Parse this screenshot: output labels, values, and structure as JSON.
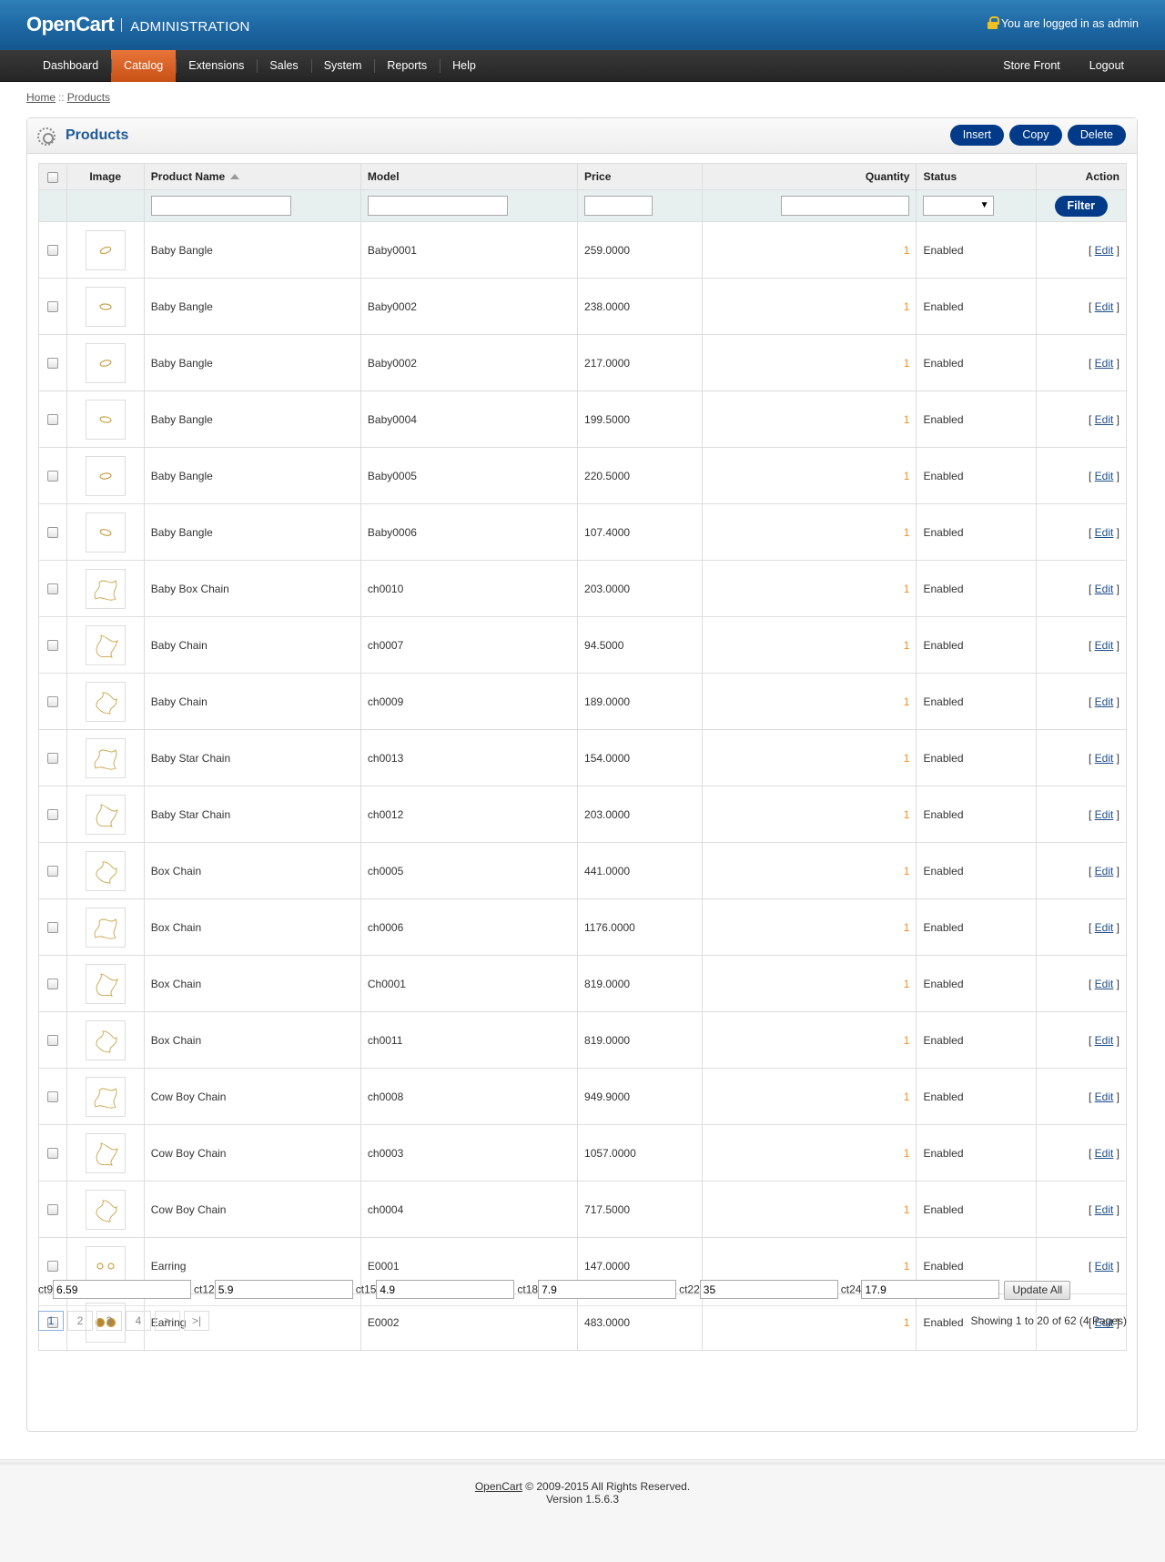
{
  "header": {
    "brand": "OpenCart",
    "subtitle": "ADMINISTRATION",
    "login_text": "You are logged in as admin",
    "lock_icon": "lock-icon"
  },
  "menu": {
    "left": [
      "Dashboard",
      "Catalog",
      "Extensions",
      "Sales",
      "System",
      "Reports",
      "Help"
    ],
    "active": "Catalog",
    "right": [
      "Store Front",
      "Logout"
    ]
  },
  "breadcrumb": {
    "home": "Home",
    "separator": "::",
    "current": "Products"
  },
  "page": {
    "title": "Products",
    "icon": "gear-icon",
    "buttons": {
      "insert": "Insert",
      "copy": "Copy",
      "delete": "Delete"
    }
  },
  "table": {
    "headers": {
      "image": "Image",
      "name": "Product Name",
      "model": "Model",
      "price": "Price",
      "quantity": "Quantity",
      "status": "Status",
      "action": "Action"
    },
    "sort_icon": "sort-asc-icon",
    "filter_button": "Filter",
    "filter_values": {
      "name": "",
      "model": "",
      "price": "",
      "quantity": "",
      "status": ""
    },
    "rows": [
      {
        "image": "bangle-thumbnail",
        "name": "Baby Bangle",
        "model": "Baby0001",
        "price": "259.0000",
        "quantity": "1",
        "status": "Enabled",
        "action": "Edit"
      },
      {
        "image": "bangle-thumbnail",
        "name": "Baby Bangle",
        "model": "Baby0002",
        "price": "238.0000",
        "quantity": "1",
        "status": "Enabled",
        "action": "Edit"
      },
      {
        "image": "bangle-thumbnail",
        "name": "Baby Bangle",
        "model": "Baby0002",
        "price": "217.0000",
        "quantity": "1",
        "status": "Enabled",
        "action": "Edit"
      },
      {
        "image": "bangle-thumbnail",
        "name": "Baby Bangle",
        "model": "Baby0004",
        "price": "199.5000",
        "quantity": "1",
        "status": "Enabled",
        "action": "Edit"
      },
      {
        "image": "bangle-thumbnail",
        "name": "Baby Bangle",
        "model": "Baby0005",
        "price": "220.5000",
        "quantity": "1",
        "status": "Enabled",
        "action": "Edit"
      },
      {
        "image": "bangle-thumbnail",
        "name": "Baby Bangle",
        "model": "Baby0006",
        "price": "107.4000",
        "quantity": "1",
        "status": "Enabled",
        "action": "Edit"
      },
      {
        "image": "chain-thumbnail",
        "name": "Baby Box Chain",
        "model": "ch0010",
        "price": "203.0000",
        "quantity": "1",
        "status": "Enabled",
        "action": "Edit"
      },
      {
        "image": "chain-thumbnail",
        "name": "Baby Chain",
        "model": "ch0007",
        "price": "94.5000",
        "quantity": "1",
        "status": "Enabled",
        "action": "Edit"
      },
      {
        "image": "chain-thumbnail",
        "name": "Baby Chain",
        "model": "ch0009",
        "price": "189.0000",
        "quantity": "1",
        "status": "Enabled",
        "action": "Edit"
      },
      {
        "image": "chain-thumbnail",
        "name": "Baby Star Chain",
        "model": "ch0013",
        "price": "154.0000",
        "quantity": "1",
        "status": "Enabled",
        "action": "Edit"
      },
      {
        "image": "chain-thumbnail",
        "name": "Baby Star Chain",
        "model": "ch0012",
        "price": "203.0000",
        "quantity": "1",
        "status": "Enabled",
        "action": "Edit"
      },
      {
        "image": "chain-thumbnail",
        "name": "Box Chain",
        "model": "ch0005",
        "price": "441.0000",
        "quantity": "1",
        "status": "Enabled",
        "action": "Edit"
      },
      {
        "image": "chain-thumbnail",
        "name": "Box Chain",
        "model": "ch0006",
        "price": "1176.0000",
        "quantity": "1",
        "status": "Enabled",
        "action": "Edit"
      },
      {
        "image": "chain-thumbnail",
        "name": "Box Chain",
        "model": "Ch0001",
        "price": "819.0000",
        "quantity": "1",
        "status": "Enabled",
        "action": "Edit"
      },
      {
        "image": "chain-thumbnail",
        "name": "Box Chain",
        "model": "ch0011",
        "price": "819.0000",
        "quantity": "1",
        "status": "Enabled",
        "action": "Edit"
      },
      {
        "image": "chain-thumbnail",
        "name": "Cow Boy Chain",
        "model": "ch0008",
        "price": "949.9000",
        "quantity": "1",
        "status": "Enabled",
        "action": "Edit"
      },
      {
        "image": "chain-thumbnail",
        "name": "Cow Boy Chain",
        "model": "ch0003",
        "price": "1057.0000",
        "quantity": "1",
        "status": "Enabled",
        "action": "Edit"
      },
      {
        "image": "chain-thumbnail",
        "name": "Cow Boy Chain",
        "model": "ch0004",
        "price": "717.5000",
        "quantity": "1",
        "status": "Enabled",
        "action": "Edit"
      },
      {
        "image": "earring-thumbnail",
        "name": "Earring",
        "model": "E0001",
        "price": "147.0000",
        "quantity": "1",
        "status": "Enabled",
        "action": "Edit"
      },
      {
        "image": "earring-thumbnail",
        "name": "Earring",
        "model": "E0002",
        "price": "483.0000",
        "quantity": "1",
        "status": "Enabled",
        "action": "Edit"
      }
    ]
  },
  "rates": [
    {
      "label": "ct9",
      "value": "6.59"
    },
    {
      "label": "ct12",
      "value": "5.9"
    },
    {
      "label": "ct15",
      "value": "4.9"
    },
    {
      "label": "ct18",
      "value": "7.9"
    },
    {
      "label": "ct22",
      "value": "35"
    },
    {
      "label": "ct24",
      "value": "17.9"
    }
  ],
  "update_all": "Update All",
  "pagination": {
    "pages": [
      "1",
      "2",
      "3",
      "4",
      ">",
      ">|"
    ],
    "current": "1",
    "showing": "Showing 1 to 20 of 62 (4 Pages)"
  },
  "footer": {
    "link": "OpenCart",
    "copyright": " © 2009-2015 All Rights Reserved.",
    "version": "Version 1.5.6.3"
  },
  "colors": {
    "header_blue": "#1d67a3",
    "menu_active": "#d8601f",
    "button_blue": "#003a88",
    "title_blue": "#1e5a96",
    "quantity_orange": "#f58a1f",
    "jewelry_gold": "#c9a24a"
  }
}
